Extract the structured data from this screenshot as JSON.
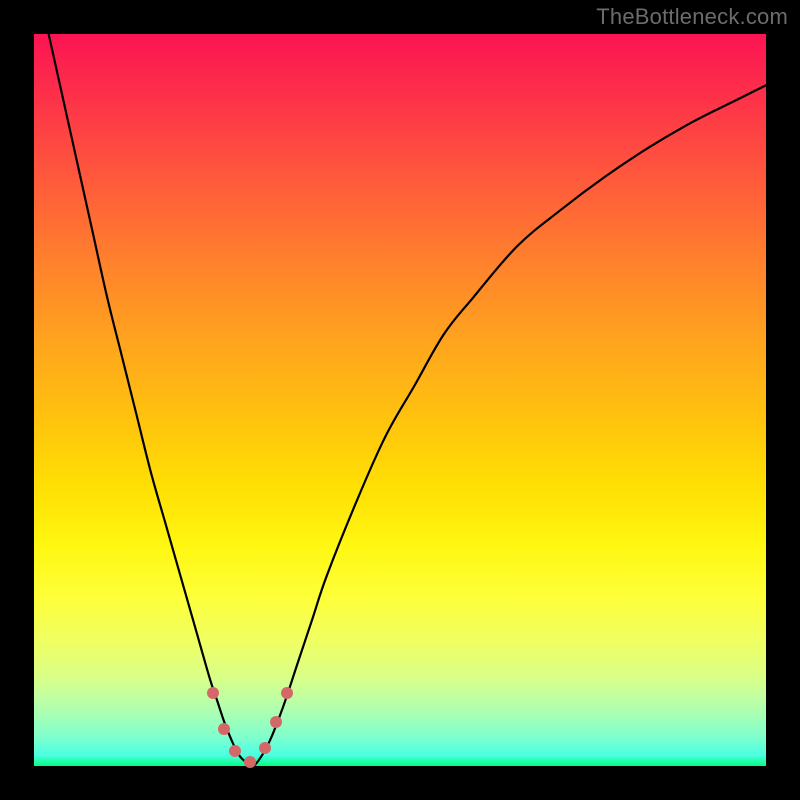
{
  "attribution": "TheBottleneck.com",
  "colors": {
    "marker": "#d46868",
    "curve": "#000000"
  },
  "chart_data": {
    "type": "line",
    "title": "",
    "xlabel": "",
    "ylabel": "",
    "x_range": [
      0,
      100
    ],
    "y_range": [
      0,
      100
    ],
    "series": [
      {
        "name": "bottleneck-curve",
        "x": [
          2,
          4,
          6,
          8,
          10,
          12,
          14,
          16,
          18,
          20,
          22,
          24,
          25,
          26,
          27,
          28,
          29,
          30,
          32,
          34,
          36,
          38,
          40,
          44,
          48,
          52,
          56,
          60,
          66,
          72,
          78,
          84,
          90,
          96,
          100
        ],
        "values": [
          100,
          91,
          82,
          73,
          64,
          56,
          48,
          40,
          33,
          26,
          19,
          12,
          9,
          6,
          3.5,
          1.5,
          0.5,
          0,
          3,
          8,
          14,
          20,
          26,
          36,
          45,
          52,
          59,
          64,
          71,
          76,
          80.5,
          84.5,
          88,
          91,
          93
        ]
      }
    ],
    "markers": [
      {
        "x": 24.5,
        "y": 10
      },
      {
        "x": 26.0,
        "y": 5
      },
      {
        "x": 27.5,
        "y": 2
      },
      {
        "x": 29.5,
        "y": 0.5
      },
      {
        "x": 31.5,
        "y": 2.5
      },
      {
        "x": 33.0,
        "y": 6
      },
      {
        "x": 34.5,
        "y": 10
      }
    ],
    "gradient_note": "vertical red→orange→yellow→green background"
  }
}
